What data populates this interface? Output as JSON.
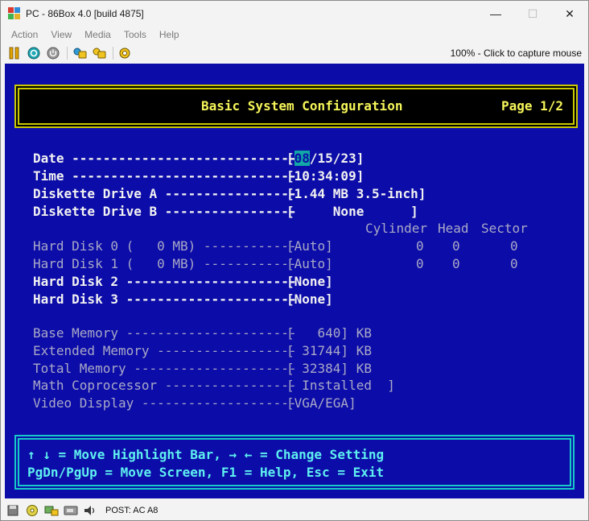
{
  "window": {
    "title": "PC - 86Box 4.0 [build 4875]",
    "minimize": "—",
    "maximize": "☐",
    "close": "✕"
  },
  "menu": [
    "Action",
    "View",
    "Media",
    "Tools",
    "Help"
  ],
  "toolbar": {
    "buttons": [
      "pause-icon",
      "reset-icon",
      "power-icon",
      "hard-reset-icon",
      "ctrl-alt-del-icon",
      "settings-icon"
    ],
    "status": "100% - Click to capture mouse"
  },
  "bios": {
    "title": "Basic System Configuration",
    "page": "Page 1/2",
    "rows": [
      {
        "label": "Date ----------------------------- ",
        "value": "[08/15/23]"
      },
      {
        "label": "Time ----------------------------- ",
        "value": "[10:34:09]"
      },
      {
        "label": "Diskette Drive A ----------------- ",
        "value": "[1.44 MB 3.5-inch]"
      },
      {
        "label": "Diskette Drive B ----------------- ",
        "value": "[     None      ]"
      },
      {
        "label": "Hard Disk 0 (   0 MB) ------------ ",
        "value": "[Auto]"
      },
      {
        "label": "Hard Disk 1 (   0 MB) ------------ ",
        "value": "[Auto]"
      },
      {
        "label": "Hard Disk 2 ---------------------- ",
        "value": "[None]"
      },
      {
        "label": "Hard Disk 3 ---------------------- ",
        "value": "[None]"
      },
      {
        "label": "Base Memory ---------------------- ",
        "value": "[   640] KB"
      },
      {
        "label": "Extended Memory ------------------ ",
        "value": "[ 31744] KB"
      },
      {
        "label": "Total Memory --------------------- ",
        "value": "[ 32384] KB"
      },
      {
        "label": "Math Coprocessor ----------------- ",
        "value": "[ Installed  ]"
      },
      {
        "label": "Video Display -------------------- ",
        "value": "[VGA/EGA]"
      }
    ],
    "date_cursor": "08",
    "date_rest": "/15/23]",
    "columns": {
      "cylinder": "Cylinder",
      "head": "Head",
      "sector": "Sector"
    },
    "hd0": {
      "cyl": "0",
      "head": "0",
      "sector": "0"
    },
    "hd1": {
      "cyl": "0",
      "head": "0",
      "sector": "0"
    },
    "help": {
      "line1": "↑ ↓ = Move Highlight Bar, → ← = Change Setting",
      "line2": "PgDn/PgUp = Move Screen, F1 = Help, Esc = Exit"
    }
  },
  "statusbar": {
    "icons": [
      "floppy-icon",
      "cdrom-icon",
      "network-icon",
      "hard-disk-icon",
      "sound-icon"
    ],
    "text": "POST: AC A8"
  },
  "colors": {
    "bios_bg": "#0c0ca8",
    "header_border": "#c9c900",
    "header_text": "#f6f65a",
    "help_border": "#17c9c9",
    "help_text": "#5ef0f0",
    "cursor": "#12a6a6"
  }
}
